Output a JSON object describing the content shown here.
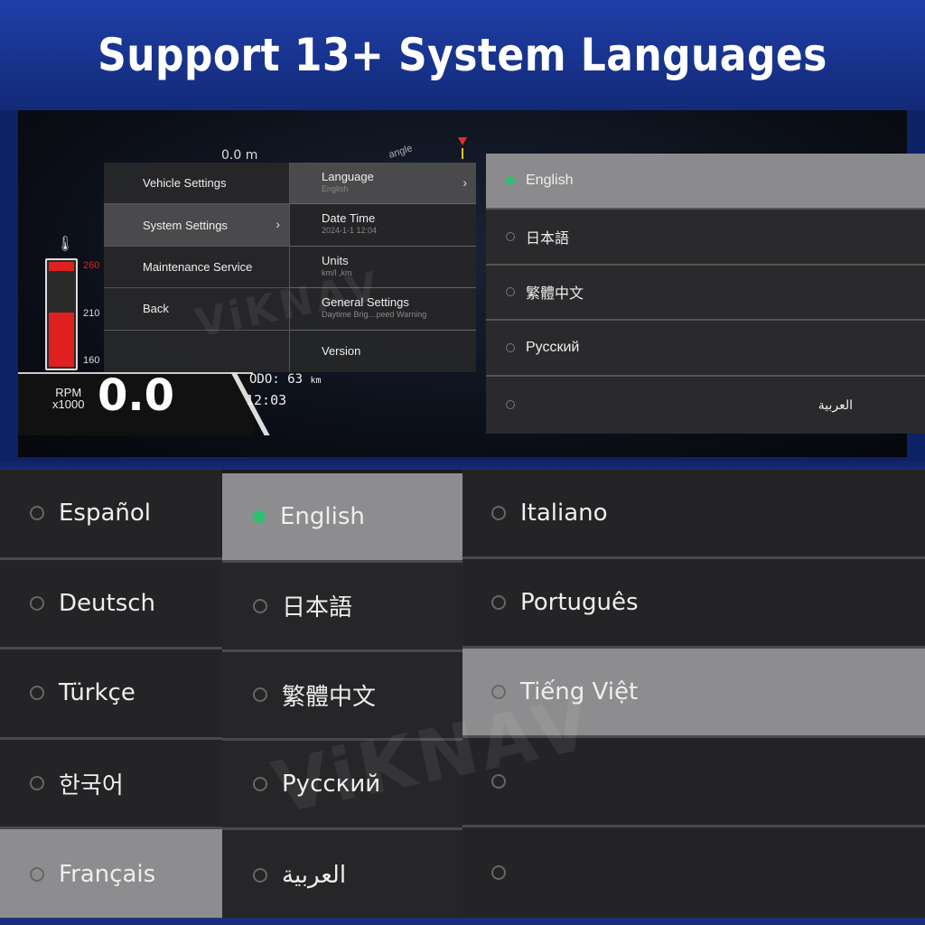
{
  "banner": {
    "title": "Support 13+ System Languages"
  },
  "cluster": {
    "distance": "0.0 m",
    "angle_label": "angle",
    "temp_ticks": [
      "260",
      "210",
      "160"
    ],
    "rpm_label_line1": "RPM",
    "rpm_label_line2": "x1000",
    "rpm_value": "0.0",
    "odo_label": "ODO:",
    "odo_value": "63",
    "odo_unit": "km",
    "clock": "12:03"
  },
  "menu": {
    "level1": [
      {
        "label": "Vehicle Settings"
      },
      {
        "label": "System Settings",
        "chevron": "›"
      },
      {
        "label": "Maintenance Service"
      },
      {
        "label": "Back"
      },
      {
        "label": ""
      }
    ],
    "level2": [
      {
        "title": "Language",
        "subtitle": "English",
        "chevron": "›"
      },
      {
        "title": "Date Time",
        "subtitle": "2024-1-1 12:04"
      },
      {
        "title": "Units",
        "subtitle": "km/l ,km"
      },
      {
        "title": "General Settings",
        "subtitle": "Daytime Brig…peed Warning"
      },
      {
        "title": "Version"
      }
    ]
  },
  "top_languages": [
    "English",
    "日本語",
    "繁體中文",
    "Русский",
    "العربية"
  ],
  "bottom_languages": {
    "col_a": [
      "Español",
      "Deutsch",
      "Türkçe",
      "한국어",
      "Français"
    ],
    "col_b": [
      "English",
      "日本語",
      "繁體中文",
      "Русский",
      "العربية"
    ],
    "col_c": [
      "Italiano",
      "Português",
      "Tiếng Việt",
      "",
      ""
    ]
  },
  "watermark": "ViKNAV",
  "colors": {
    "banner": "#1c3a9c",
    "selected_radio": "#2fbf71",
    "selected_row": "#8b8b8d",
    "temp_fill": "#e01f1f"
  }
}
